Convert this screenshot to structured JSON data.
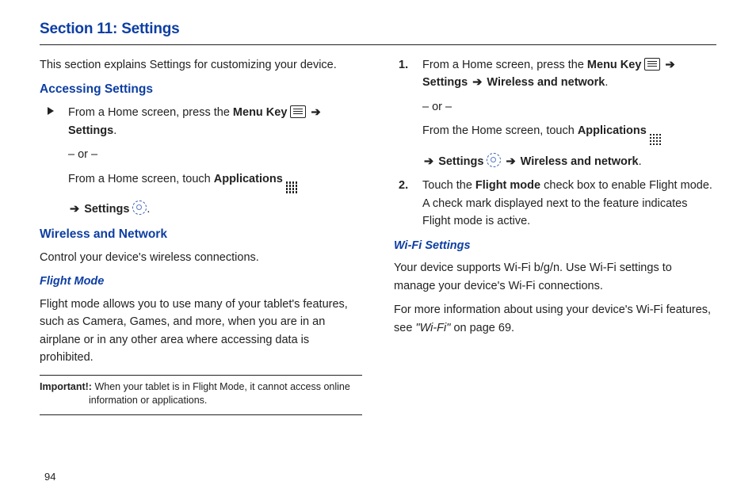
{
  "title": "Section 11: Settings",
  "intro": "This section explains Settings for customizing your device.",
  "left": {
    "h2a": "Accessing Settings",
    "step1a": "From a Home screen, press the ",
    "menu_key": "Menu Key",
    "settings": "Settings",
    "or": "– or –",
    "step1b": "From a Home screen, touch ",
    "applications": "Applications",
    "h2b": "Wireless and Network",
    "p2": "Control your device's wireless connections.",
    "h3a": "Flight Mode",
    "p3": "Flight mode allows you to use many of your tablet's features, such as Camera, Games, and more, when you are in an airplane or in any other area where accessing data is prohibited.",
    "note_label": "Important!:",
    "note_text": "When your tablet is in Flight Mode, it cannot access online information or applications."
  },
  "right": {
    "s1a": "From a Home screen, press the ",
    "menu_key": "Menu Key",
    "settings": "Settings",
    "wireless": "Wireless and network",
    "or": "– or –",
    "s1b": "From the Home screen, touch ",
    "applications": "Applications",
    "s2a": "Touch the ",
    "flight_mode": "Flight mode",
    "s2b": " check box to enable Flight mode. A check mark displayed next to the feature indicates Flight mode is active.",
    "h3b": "Wi-Fi Settings",
    "p4": "Your device supports Wi-Fi b/g/n. Use Wi-Fi settings to manage your device's Wi-Fi connections.",
    "p5a": "For more information about using your device's Wi-Fi features, see ",
    "p5ref": "\"Wi-Fi\"",
    "p5b": " on page 69."
  },
  "page_number": "94"
}
